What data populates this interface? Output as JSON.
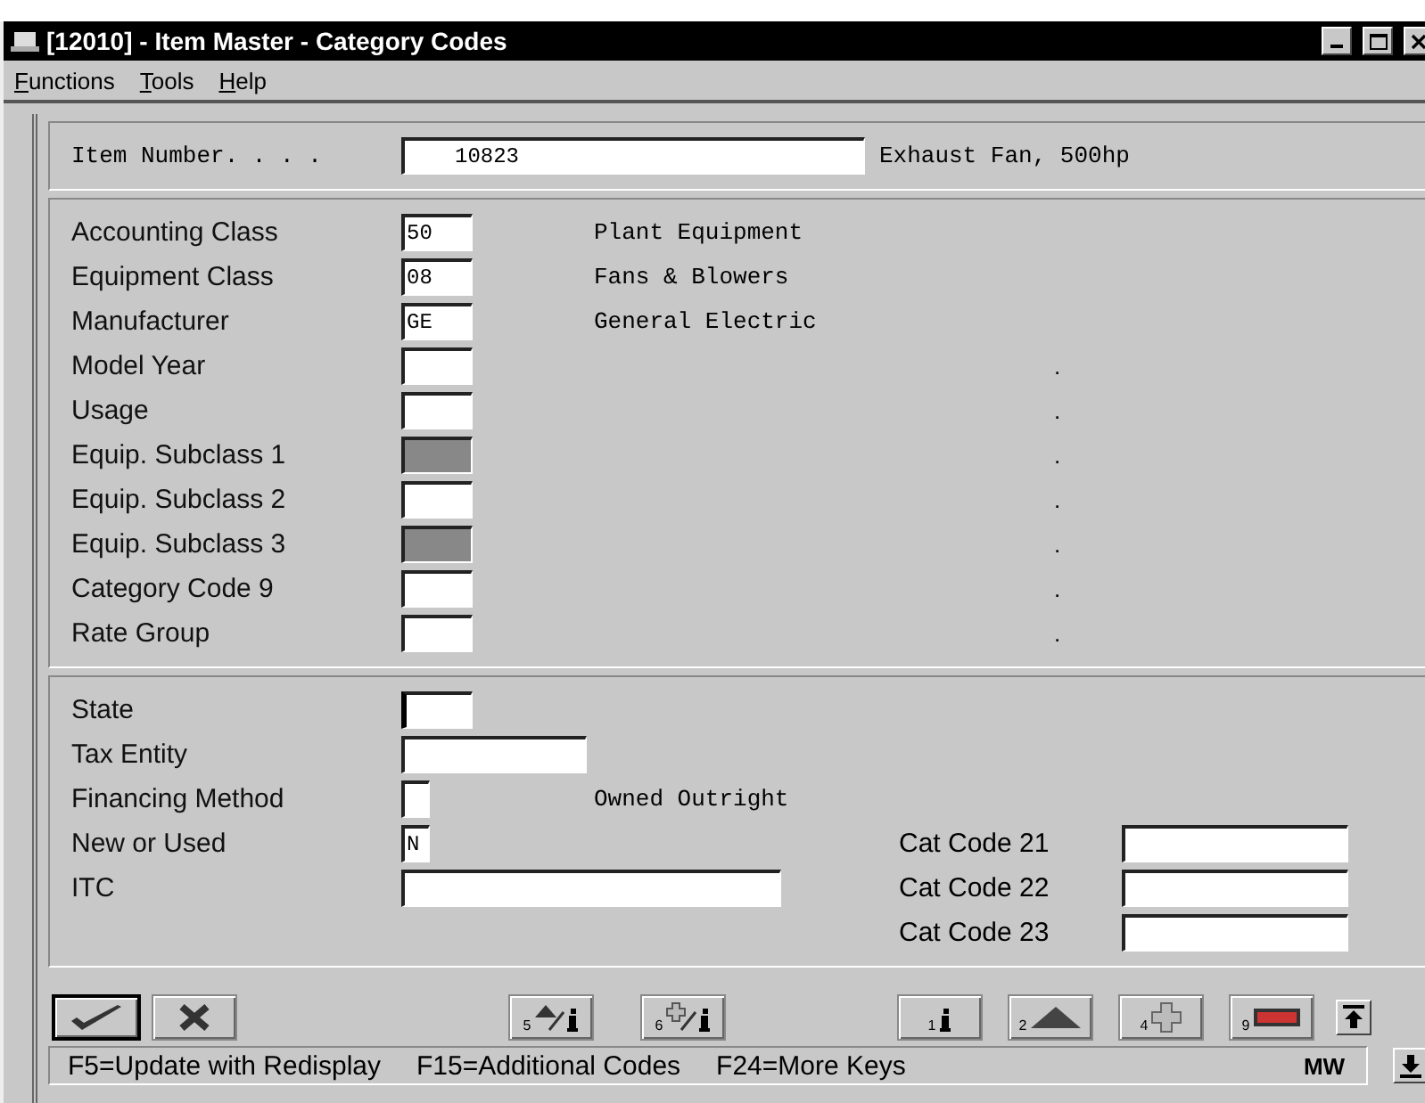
{
  "window": {
    "title": "[12010] - Item Master - Category Codes"
  },
  "menu": [
    {
      "access_key": "F",
      "rest": "unctions"
    },
    {
      "access_key": "T",
      "rest": "ools"
    },
    {
      "access_key": "H",
      "rest": "elp"
    }
  ],
  "item": {
    "label": "Item Number. . . .",
    "value": "10823",
    "description": "Exhaust Fan, 500hp"
  },
  "class_fields": [
    {
      "label": "Accounting Class",
      "value": "50",
      "description": "Plant Equipment",
      "disabled": false,
      "focused": false
    },
    {
      "label": "Equipment Class",
      "value": "08",
      "description": "Fans & Blowers",
      "disabled": false,
      "focused": false
    },
    {
      "label": "Manufacturer",
      "value": "GE",
      "description": "General Electric",
      "disabled": false,
      "focused": false
    },
    {
      "label": "Model Year",
      "marker": ".",
      "disabled": false,
      "focused": false
    },
    {
      "label": "Usage",
      "marker": ".",
      "disabled": false,
      "focused": false
    },
    {
      "label": "Equip. Subclass 1",
      "marker": ".",
      "disabled": true,
      "focused": false
    },
    {
      "label": "Equip. Subclass 2",
      "marker": ".",
      "disabled": false,
      "focused": false
    },
    {
      "label": "Equip. Subclass 3",
      "marker": ".",
      "disabled": true,
      "focused": false
    },
    {
      "label": "Category Code 9",
      "marker": ".",
      "disabled": false,
      "focused": false
    },
    {
      "label": "Rate Group",
      "marker": ".",
      "disabled": false,
      "focused": false
    }
  ],
  "lower_fields": [
    {
      "label": "State",
      "kind": "small",
      "focused": true
    },
    {
      "label": "Tax Entity",
      "kind": "medium",
      "focused": false
    },
    {
      "label": "Financing Method",
      "kind": "char",
      "description": "Owned Outright",
      "focused": false
    },
    {
      "label": "New or Used",
      "kind": "char",
      "value": "N",
      "focused": false
    },
    {
      "label": "ITC",
      "kind": "long",
      "focused": false
    }
  ],
  "cat_codes": [
    {
      "label": "Cat Code 21"
    },
    {
      "label": "Cat Code 22"
    },
    {
      "label": "Cat Code 23"
    }
  ],
  "buttons": [
    {
      "kind": "ok",
      "default": true
    },
    {
      "kind": "cancel",
      "default": false
    },
    {
      "kind": "up_info",
      "key": "5",
      "default": false
    },
    {
      "kind": "add_info",
      "key": "6",
      "default": false
    },
    {
      "kind": "info",
      "key": "1",
      "default": false
    },
    {
      "kind": "up",
      "key": "2",
      "default": false
    },
    {
      "kind": "add",
      "key": "4",
      "default": false
    },
    {
      "kind": "bar",
      "key": "9",
      "default": false
    }
  ],
  "status_bar": {
    "hints": [
      "F5=Update with Redisplay",
      "F15=Additional Codes",
      "F24=More Keys"
    ],
    "user": "MW"
  }
}
